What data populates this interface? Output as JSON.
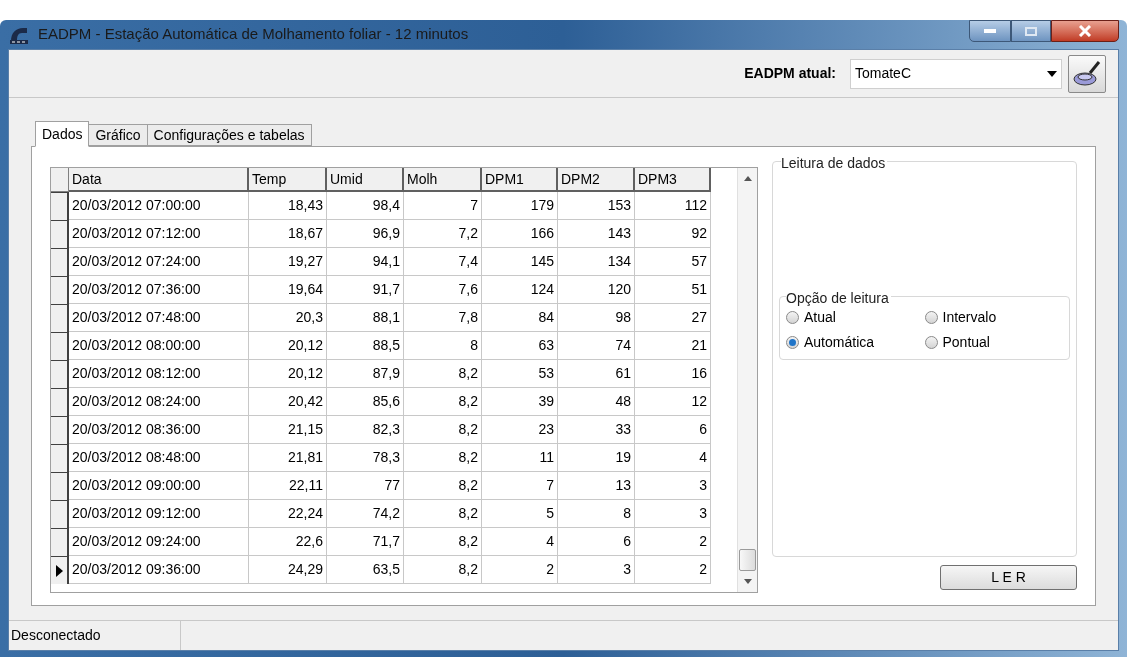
{
  "window": {
    "title": "EADPM - Estação Automática de Molhamento foliar - 12 minutos"
  },
  "station": {
    "label": "EADPM atual:",
    "value": "TomateC"
  },
  "tabs": [
    {
      "label": "Dados",
      "selected": true
    },
    {
      "label": "Gráfico",
      "selected": false
    },
    {
      "label": "Configurações e tabelas",
      "selected": false
    }
  ],
  "table": {
    "columns": [
      "Data",
      "Temp",
      "Umid",
      "Molh",
      "DPM1",
      "DPM2",
      "DPM3"
    ],
    "rows": [
      {
        "cells": [
          "20/03/2012 07:00:00",
          "18,43",
          "98,4",
          "7",
          "179",
          "153",
          "112"
        ],
        "selected": false
      },
      {
        "cells": [
          "20/03/2012 07:12:00",
          "18,67",
          "96,9",
          "7,2",
          "166",
          "143",
          "92"
        ],
        "selected": false
      },
      {
        "cells": [
          "20/03/2012 07:24:00",
          "19,27",
          "94,1",
          "7,4",
          "145",
          "134",
          "57"
        ],
        "selected": false
      },
      {
        "cells": [
          "20/03/2012 07:36:00",
          "19,64",
          "91,7",
          "7,6",
          "124",
          "120",
          "51"
        ],
        "selected": false
      },
      {
        "cells": [
          "20/03/2012 07:48:00",
          "20,3",
          "88,1",
          "7,8",
          "84",
          "98",
          "27"
        ],
        "selected": false
      },
      {
        "cells": [
          "20/03/2012 08:00:00",
          "20,12",
          "88,5",
          "8",
          "63",
          "74",
          "21"
        ],
        "selected": false
      },
      {
        "cells": [
          "20/03/2012 08:12:00",
          "20,12",
          "87,9",
          "8,2",
          "53",
          "61",
          "16"
        ],
        "selected": false
      },
      {
        "cells": [
          "20/03/2012 08:24:00",
          "20,42",
          "85,6",
          "8,2",
          "39",
          "48",
          "12"
        ],
        "selected": false
      },
      {
        "cells": [
          "20/03/2012 08:36:00",
          "21,15",
          "82,3",
          "8,2",
          "23",
          "33",
          "6"
        ],
        "selected": false
      },
      {
        "cells": [
          "20/03/2012 08:48:00",
          "21,81",
          "78,3",
          "8,2",
          "11",
          "19",
          "4"
        ],
        "selected": false
      },
      {
        "cells": [
          "20/03/2012 09:00:00",
          "22,11",
          "77",
          "8,2",
          "7",
          "13",
          "3"
        ],
        "selected": false
      },
      {
        "cells": [
          "20/03/2012 09:12:00",
          "22,24",
          "74,2",
          "8,2",
          "5",
          "8",
          "3"
        ],
        "selected": false
      },
      {
        "cells": [
          "20/03/2012 09:24:00",
          "22,6",
          "71,7",
          "8,2",
          "4",
          "6",
          "2"
        ],
        "selected": false
      },
      {
        "cells": [
          "20/03/2012 09:36:00",
          "24,29",
          "63,5",
          "8,2",
          "2",
          "3",
          "2"
        ],
        "selected": true
      }
    ]
  },
  "reading_panel": {
    "title": "Leitura de dados",
    "options_title": "Opção de leitura",
    "options": [
      {
        "label": "Atual",
        "selected": false
      },
      {
        "label": "Intervalo",
        "selected": false
      },
      {
        "label": "Automática",
        "selected": true
      },
      {
        "label": "Pontual",
        "selected": false
      }
    ],
    "button": "L E R"
  },
  "status_bar": {
    "text": "Desconectado"
  }
}
